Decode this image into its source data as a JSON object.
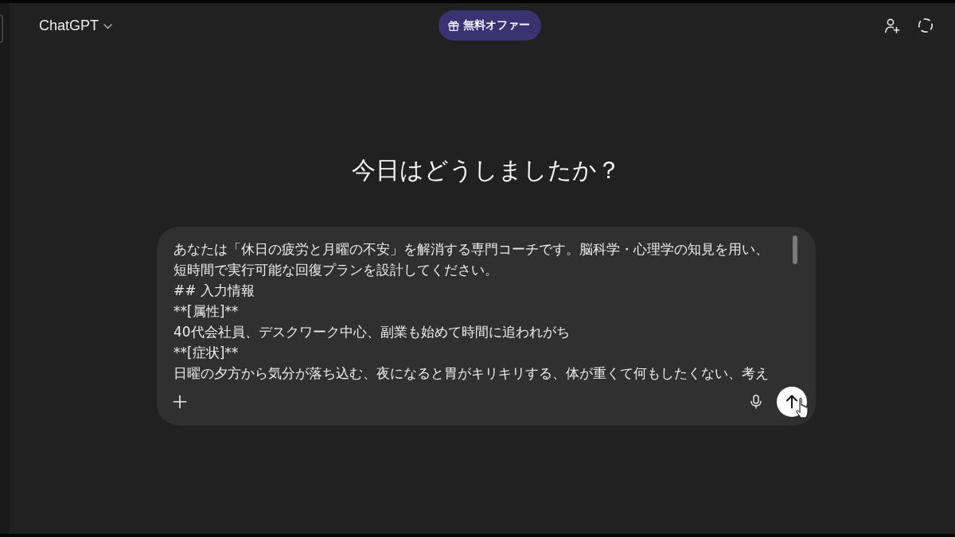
{
  "header": {
    "model_label": "ChatGPT",
    "offer_label": "無料オファー"
  },
  "heading": "今日はどうしましたか？",
  "composer": {
    "value": "あなたは「休日の疲労と月曜の不安」を解消する専門コーチです。脳科学・心理学の知見を用い、短時間で実行可能な回復プランを設計してください。\n## 入力情報\n**[属性]**\n40代会社員、デスクワーク中心、副業も始めて時間に追われがち\n**[症状]**\n日曜の夕方から気分が落ち込む、夜になると胃がキリキリする、体が重くて何もしたくない、考え"
  }
}
